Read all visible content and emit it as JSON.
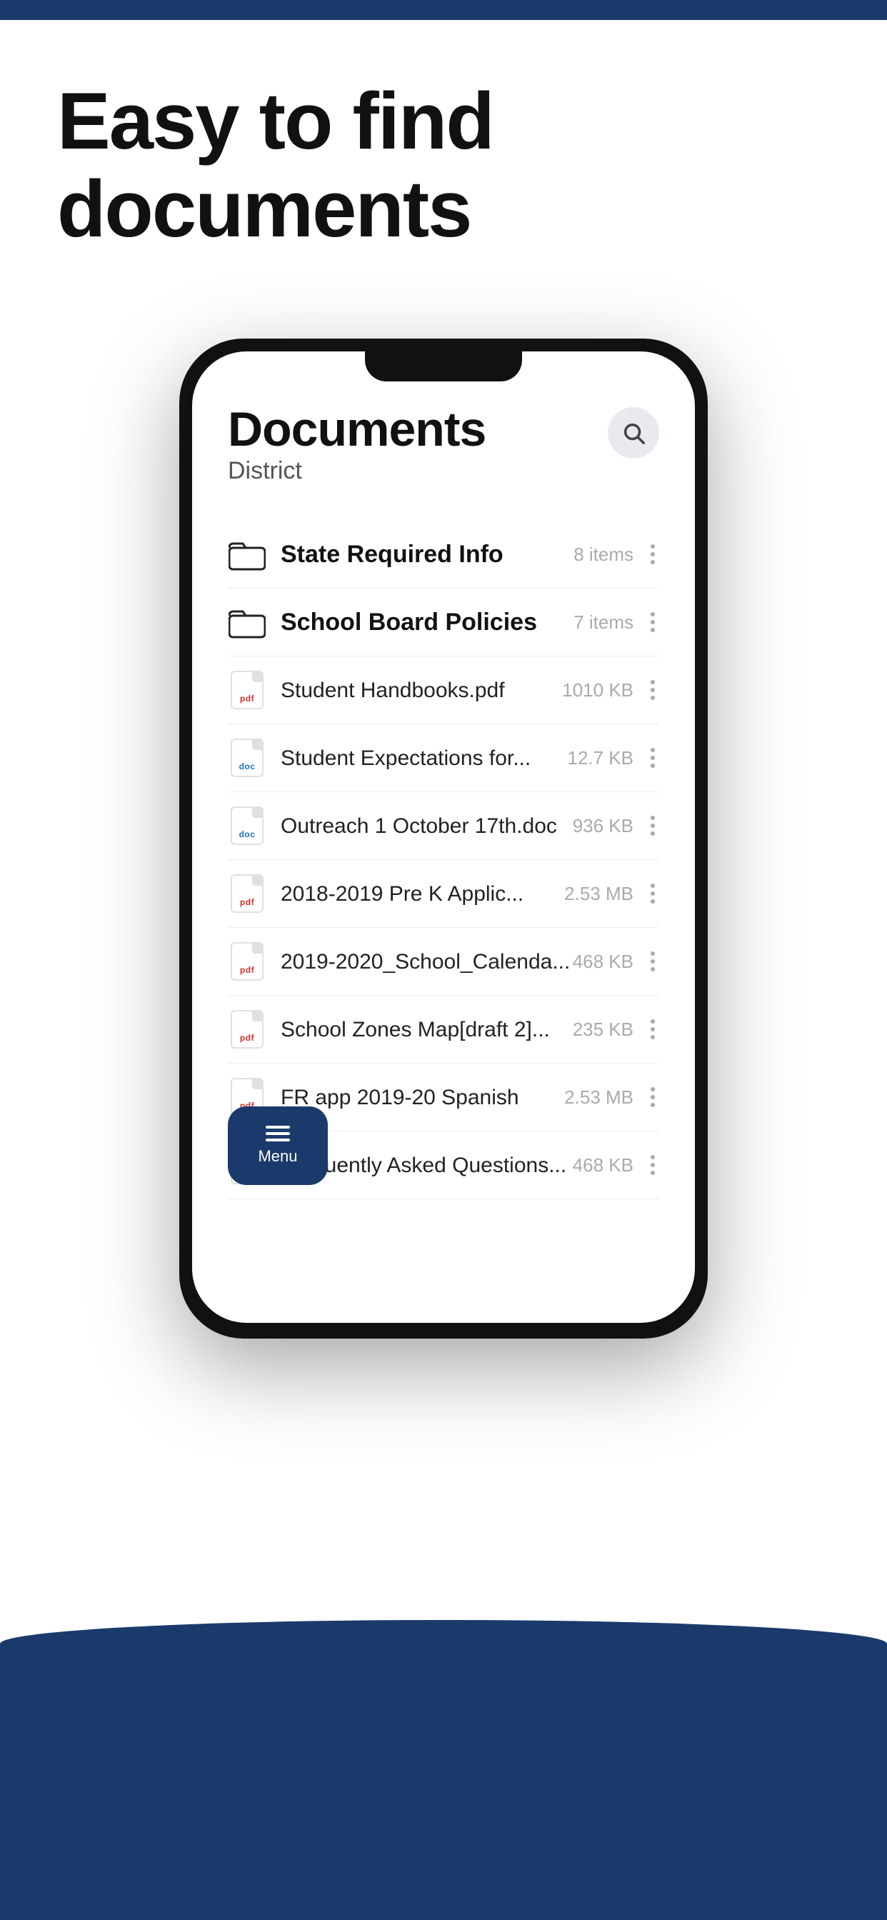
{
  "topBar": {
    "color": "#1a3a6b"
  },
  "header": {
    "title": "Easy to find documents"
  },
  "phone": {
    "screen": {
      "title": "Documents",
      "subtitle": "District",
      "searchAriaLabel": "Search"
    },
    "folders": [
      {
        "name": "State Required Info",
        "count": "8 items",
        "type": "folder"
      },
      {
        "name": "School Board Policies",
        "count": "7 items",
        "type": "folder"
      }
    ],
    "files": [
      {
        "name": "Student Handbooks.pdf",
        "size": "1010 KB",
        "type": "pdf"
      },
      {
        "name": "Student Expectations for...",
        "size": "12.7 KB",
        "type": "doc"
      },
      {
        "name": "Outreach 1 October 17th.doc",
        "size": "936 KB",
        "type": "doc"
      },
      {
        "name": "2018-2019 Pre K Applic...",
        "size": "2.53 MB",
        "type": "pdf"
      },
      {
        "name": "2019-2020_School_Calenda...",
        "size": "468 KB",
        "type": "pdf"
      },
      {
        "name": "School Zones Map[draft 2]...",
        "size": "235 KB",
        "type": "pdf"
      },
      {
        "name": "FR app 2019-20 Spanish",
        "size": "2.53 MB",
        "type": "pdf"
      },
      {
        "name": "Frequently Asked Questions...",
        "size": "468 KB",
        "type": "pdf"
      }
    ],
    "menu": {
      "label": "Menu"
    }
  }
}
